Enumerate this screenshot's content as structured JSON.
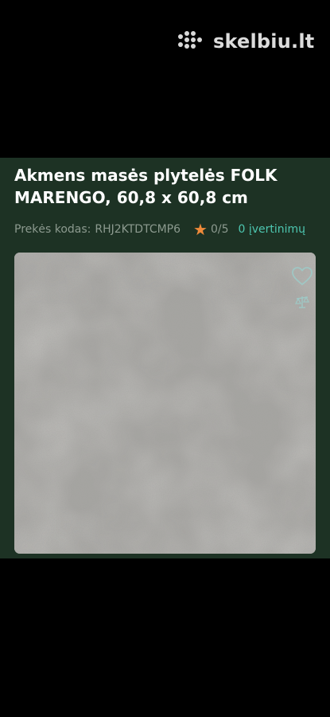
{
  "watermark": {
    "text": "skelbiu.lt",
    "icon": "skelbiu-dots-logo-icon"
  },
  "product": {
    "title": "Akmens masės plytelės FOLK MARENGO, 60,8 x 60,8 cm",
    "code_label": "Prekės kodas:",
    "code_value": "RHJ2KTDTCMP6",
    "rating": "0/5",
    "reviews": "0 įvertinimų"
  },
  "image": {
    "description_icons": [
      "heart-icon",
      "compare-scale-icon"
    ]
  },
  "colors": {
    "background": "#000000",
    "panel": "#1d3224",
    "star": "#ef8a3a",
    "reviews_link": "#4dc6b0",
    "muted_text": "#8c9a8f",
    "tile": "#a6a5a2"
  }
}
